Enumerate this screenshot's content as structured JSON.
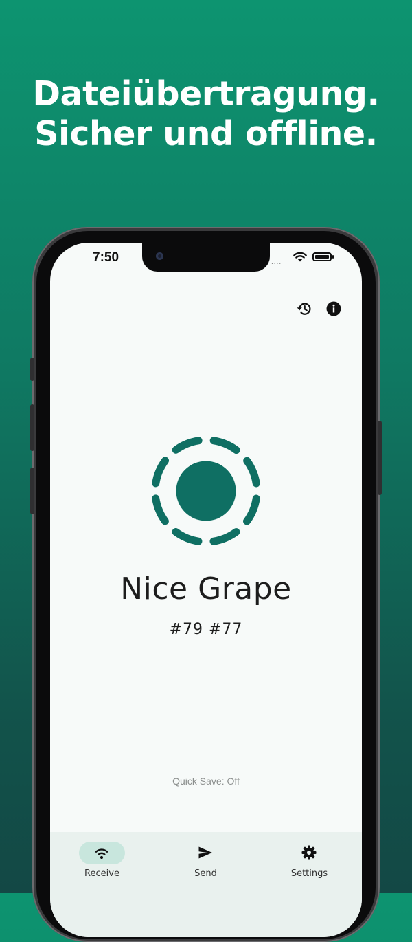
{
  "headline": {
    "line1": "Dateiübertragung.",
    "line2": "Sicher und offline."
  },
  "status_bar": {
    "time": "7:50",
    "signal": "....",
    "icons": [
      "wifi-icon",
      "battery-icon"
    ]
  },
  "toolbar": {
    "icons": [
      "history-icon",
      "info-icon"
    ]
  },
  "device": {
    "name": "Nice Grape",
    "id": "#79 #77"
  },
  "quick_save": "Quick Save: Off",
  "nav": {
    "items": [
      {
        "label": "Receive",
        "icon": "wifi-icon",
        "active": true
      },
      {
        "label": "Send",
        "icon": "send-icon",
        "active": false
      },
      {
        "label": "Settings",
        "icon": "gear-icon",
        "active": false
      }
    ]
  },
  "colors": {
    "brand": "#0f6f63",
    "background_top": "#0d9470",
    "background_bottom": "#134845",
    "nav_active_pill": "#c8e6dd"
  }
}
